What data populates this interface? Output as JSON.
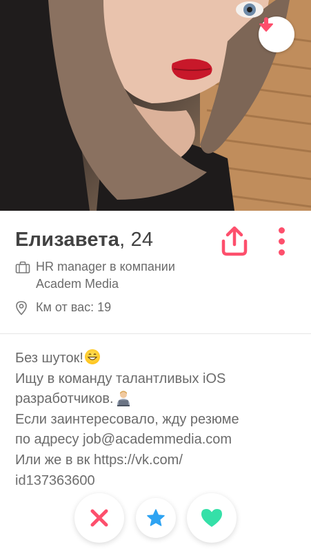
{
  "profile": {
    "name": "Елизавета",
    "age": ", 24",
    "job": [
      "HR manager в компании",
      "Academ Media"
    ],
    "distance": "Км от вас: 19",
    "bio": {
      "line1": "Без шуток!",
      "line2": "Ищу в команду талантливых iOS",
      "line3": "разработчиков.",
      "line4": "Если заинтересовало, жду резюме",
      "line5": "по адресу job@academmedia.com",
      "line6": "Или же в вк https://vk.com/",
      "line7": "id137363600"
    }
  },
  "colors": {
    "accent": "#fd4f6c",
    "nope": "#fd4f6c",
    "star": "#2ea3f2",
    "like": "#35e0a8"
  },
  "icons": {
    "collapse": "arrow-down-icon",
    "share": "share-icon",
    "more": "more-vertical-icon",
    "job": "briefcase-icon",
    "location": "location-pin-icon",
    "nope": "close-icon",
    "superlike": "star-icon",
    "like": "heart-icon"
  }
}
